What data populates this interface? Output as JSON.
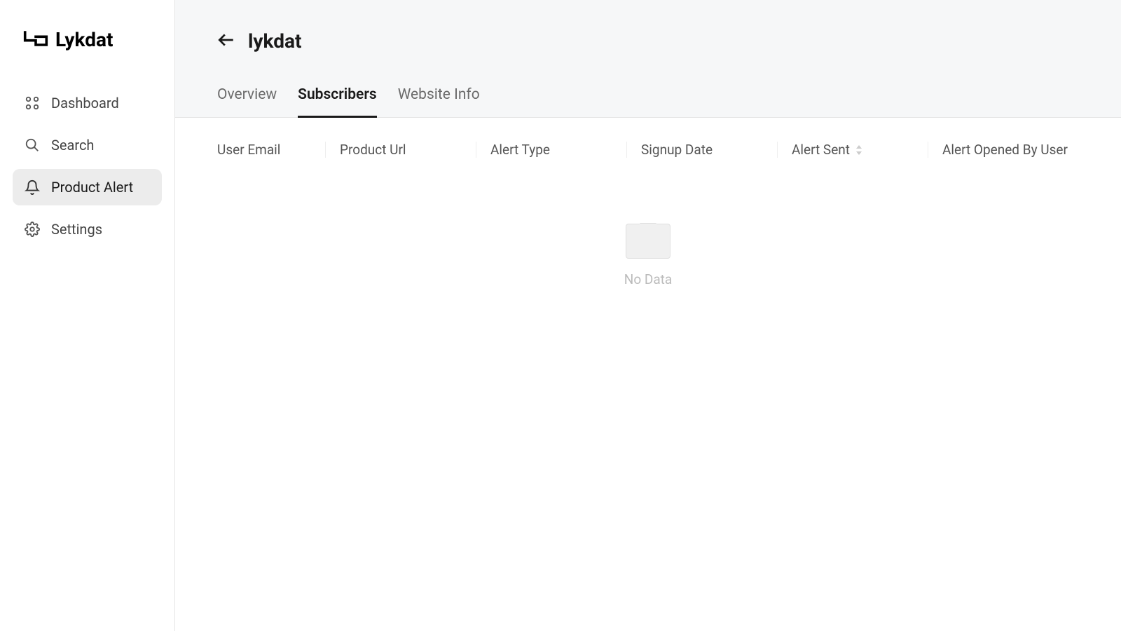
{
  "brand": {
    "name": "Lykdat"
  },
  "sidebar": {
    "items": [
      {
        "label": "Dashboard",
        "icon": "dashboard-icon",
        "active": false
      },
      {
        "label": "Search",
        "icon": "search-icon",
        "active": false
      },
      {
        "label": "Product Alert",
        "icon": "bell-icon",
        "active": true
      },
      {
        "label": "Settings",
        "icon": "gear-icon",
        "active": false
      }
    ]
  },
  "header": {
    "title": "lykdat"
  },
  "tabs": [
    {
      "label": "Overview",
      "active": false
    },
    {
      "label": "Subscribers",
      "active": true
    },
    {
      "label": "Website Info",
      "active": false
    }
  ],
  "table": {
    "columns": [
      {
        "label": "User Email",
        "sortable": false
      },
      {
        "label": "Product Url",
        "sortable": false
      },
      {
        "label": "Alert Type",
        "sortable": false
      },
      {
        "label": "Signup Date",
        "sortable": false
      },
      {
        "label": "Alert Sent",
        "sortable": true
      },
      {
        "label": "Alert Opened By User",
        "sortable": false
      }
    ],
    "rows": [],
    "empty_text": "No Data"
  }
}
